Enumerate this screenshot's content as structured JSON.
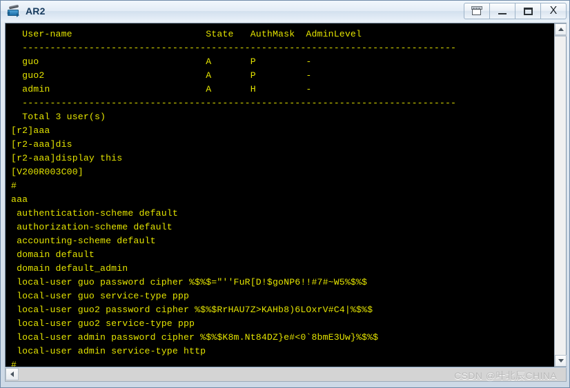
{
  "window": {
    "title": "AR2",
    "app_icon": "router-icon",
    "controls": [
      {
        "name": "cascade-button",
        "icon": "cascade-icon",
        "label": ""
      },
      {
        "name": "minimize-button",
        "icon": "minimize-icon",
        "label": ""
      },
      {
        "name": "maximize-button",
        "icon": "maximize-icon",
        "label": ""
      },
      {
        "name": "close-button",
        "icon": "close-icon",
        "label": "X"
      }
    ]
  },
  "terminal": {
    "foreground_color": "#e3e300",
    "background_color": "#000000",
    "lines": [
      "  User-name                        State   AuthMask  AdminLevel",
      "  ------------------------------------------------------------------------------",
      "  guo                              A       P         -",
      "  guo2                             A       P         -",
      "  admin                            A       H         -",
      "  ------------------------------------------------------------------------------",
      "  Total 3 user(s)",
      "[r2]aaa",
      "[r2-aaa]dis",
      "[r2-aaa]display this",
      "[V200R003C00]",
      "#",
      "aaa",
      " authentication-scheme default",
      " authorization-scheme default",
      " accounting-scheme default",
      " domain default",
      " domain default_admin",
      " local-user guo password cipher %$%$=\"''FuR[D!$goNP6!!#7#~W5%$%$",
      " local-user guo service-type ppp",
      " local-user guo2 password cipher %$%$RrHAU7Z>KAHb8)6LOxrV#C4|%$%$",
      " local-user guo2 service-type ppp",
      " local-user admin password cipher %$%$K8m.Nt84DZ}e#<0`8bmE3Uw}%$%$",
      " local-user admin service-type http",
      "#"
    ]
  },
  "scrollbars": {
    "vertical": {
      "up_icon": "chevron-up-icon",
      "down_icon": "chevron-down-icon"
    },
    "horizontal": {
      "left_icon": "chevron-left-icon"
    }
  },
  "watermark": {
    "text": "CSDN @叶北辰CHINA"
  }
}
